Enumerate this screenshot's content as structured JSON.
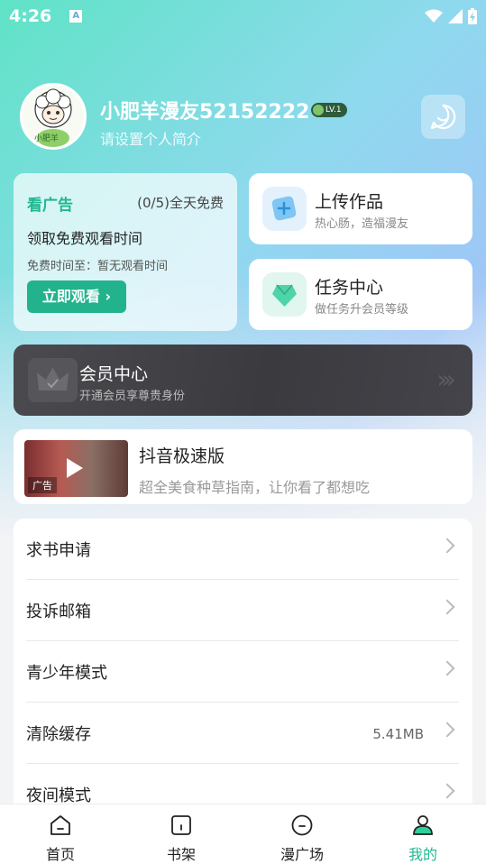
{
  "status_bar": {
    "time": "4:26",
    "notification_icon": "a-icon"
  },
  "profile": {
    "avatar_text": "小肥羊",
    "nickname": "小肥羊漫友52152222",
    "level": "LV.1",
    "bio": "请设置个人简介"
  },
  "ad_card": {
    "title": "看广告",
    "count": "(0/5)全天免费",
    "desc": "领取免费观看时间",
    "free_time": "免费时间至：暂无观看时间",
    "button": "立即观看"
  },
  "upload_card": {
    "title": "上传作品",
    "subtitle": "热心肠，造福漫友"
  },
  "task_card": {
    "title": "任务中心",
    "subtitle": "做任务升会员等级"
  },
  "vip_card": {
    "title": "会员中心",
    "subtitle": "开通会员享尊贵身份"
  },
  "douyin_ad": {
    "tag": "广告",
    "title": "抖音极速版",
    "subtitle": "超全美食种草指南，让你看了都想吃"
  },
  "menu": {
    "items": [
      {
        "label": "求书申请",
        "value": ""
      },
      {
        "label": "投诉邮箱",
        "value": ""
      },
      {
        "label": "青少年模式",
        "value": ""
      },
      {
        "label": "清除缓存",
        "value": "5.41MB"
      },
      {
        "label": "夜间模式",
        "value": ""
      }
    ]
  },
  "bottom_nav": {
    "items": [
      {
        "label": "首页"
      },
      {
        "label": "书架"
      },
      {
        "label": "漫广场"
      },
      {
        "label": "我的"
      }
    ],
    "active_color": "#20b98f"
  },
  "colors": {
    "accent": "#22b38d",
    "vip_bg": "#3a3a3f"
  }
}
